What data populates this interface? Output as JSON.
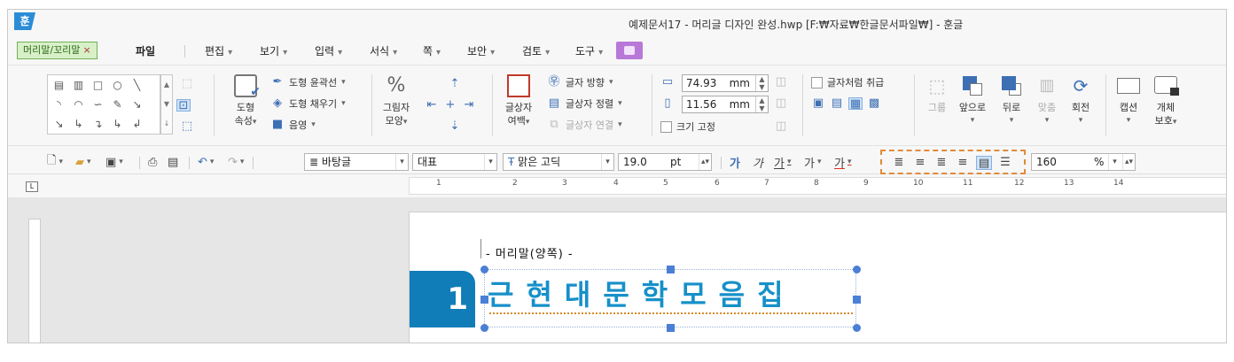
{
  "app": {
    "logo_text": "훈",
    "window_title": "예제문서17 - 머리글 디자인 완성.hwp [F:₩자료₩한글문서파일₩] - 훈글"
  },
  "menu": {
    "context_tab": "머리말/꼬리말",
    "context_tab_close": "×",
    "file": "파일",
    "items": [
      "편집",
      "보기",
      "입력",
      "서식",
      "쪽",
      "보안",
      "검토",
      "도구"
    ]
  },
  "ribbon": {
    "shape_props": {
      "label_line1": "도형",
      "label_line2": "속성"
    },
    "outline": "도형 윤곽선",
    "fill": "도형 채우기",
    "shadow": "음영",
    "image_shape": {
      "line1": "그림자",
      "line2": "모양"
    },
    "text_margin": {
      "line1": "글상자",
      "line2": "여백"
    },
    "text_direction": "글자 방향",
    "text_align": "글상자 정렬",
    "text_link": "글상자 연결",
    "width": {
      "value": "74.93",
      "unit": "mm"
    },
    "height": {
      "value": "11.56",
      "unit": "mm"
    },
    "fix_size": "크기 고정",
    "treat_as_char": "글자처럼 취급",
    "group": "그룹",
    "bring_front": "앞으로",
    "send_back": "뒤로",
    "fit": "맞춤",
    "rotate": "회전",
    "caption": "캡션",
    "protect": {
      "line1": "개체",
      "line2": "보호"
    }
  },
  "format_bar": {
    "style": "바탕글",
    "lang": "대표",
    "font": "맑은 고딕",
    "size": "19.0",
    "size_unit": "pt",
    "bold": "가",
    "italic": "가",
    "underline": "가",
    "strike": "가",
    "color": "가",
    "line_spacing": "160",
    "line_spacing_unit": "%"
  },
  "ruler": {
    "corner": "L",
    "numbers": [
      "1",
      "2",
      "3",
      "4",
      "5",
      "6",
      "7",
      "8",
      "9",
      "10",
      "11",
      "12",
      "13",
      "14"
    ]
  },
  "document": {
    "header_text": "- 머리말(양쪽) -",
    "number": "1",
    "title": "근현대문학모음집"
  }
}
